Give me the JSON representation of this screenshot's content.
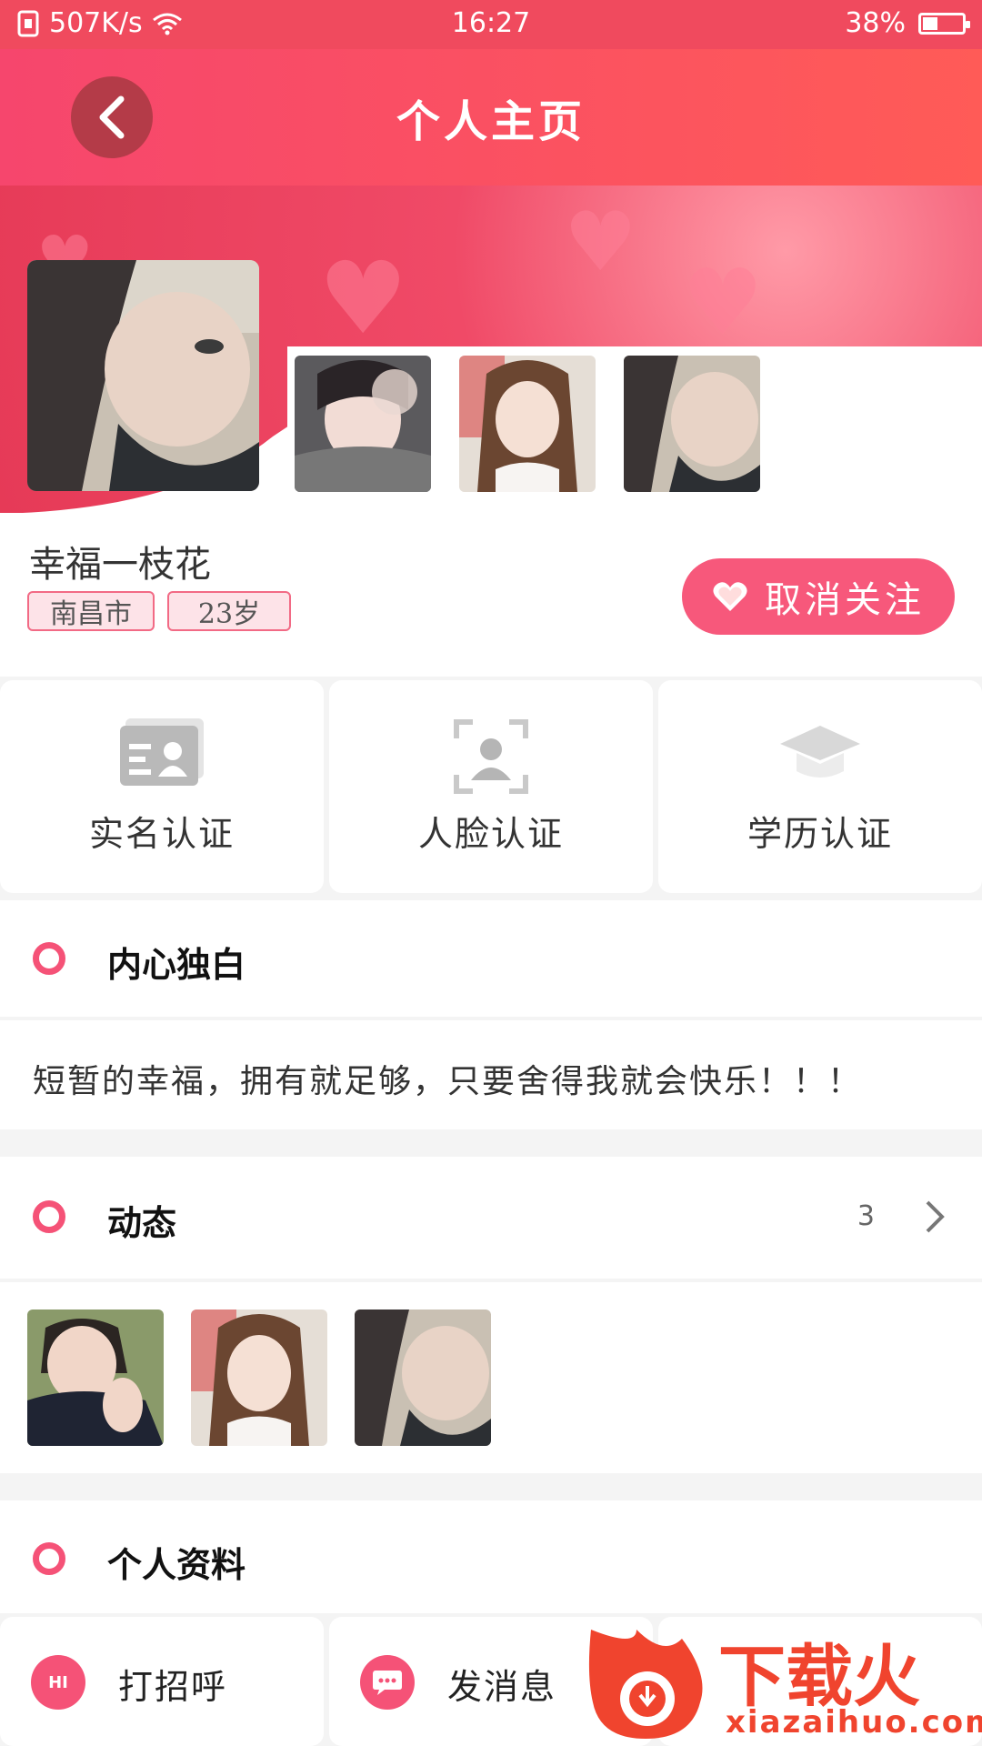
{
  "status_bar": {
    "speed": "507K/s",
    "time": "16:27",
    "battery": "38%"
  },
  "header": {
    "title": "个人主页"
  },
  "profile": {
    "name": "幸福一枝花",
    "city": "南昌市",
    "age": "23岁",
    "follow_button": "取消关注"
  },
  "verification": [
    {
      "label": "实名认证",
      "icon": "id-card-icon"
    },
    {
      "label": "人脸认证",
      "icon": "face-scan-icon"
    },
    {
      "label": "学历认证",
      "icon": "graduation-cap-icon"
    }
  ],
  "monologue": {
    "title": "内心独白",
    "text": "短暂的幸福，拥有就足够，只要舍得我就会快乐！！！"
  },
  "moments": {
    "title": "动态",
    "count": "3"
  },
  "personal_info": {
    "title": "个人资料"
  },
  "bottom_actions": {
    "greet": "打招呼",
    "greet_badge": "HI",
    "message": "发消息"
  },
  "watermark": {
    "text": "下载火",
    "site": "xiazaihuo.com"
  },
  "colors": {
    "accent": "#f55277",
    "header": "#f6466d",
    "status_bar": "#f04a5e"
  }
}
